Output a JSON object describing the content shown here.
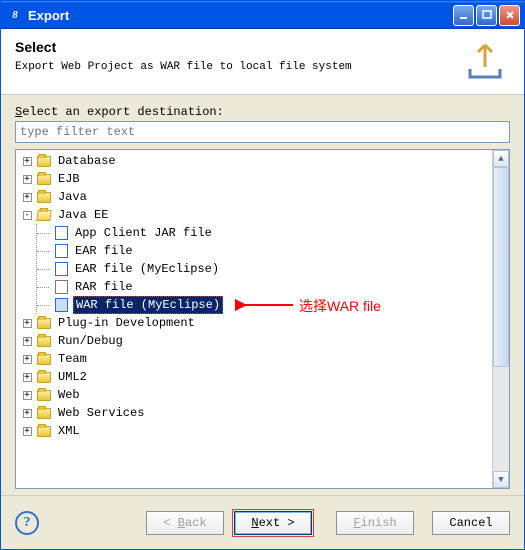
{
  "window": {
    "title": "Export"
  },
  "header": {
    "title": "Select",
    "subtitle": "Export Web Project as WAR file to local file system"
  },
  "prompt": {
    "first_char": "S",
    "rest": "elect an export destination:"
  },
  "filter": {
    "placeholder": "type filter text"
  },
  "tree": {
    "database": "Database",
    "ejb": "EJB",
    "java": "Java",
    "javaee": {
      "label": "Java EE",
      "app_client_jar": "App Client JAR file",
      "ear_file": "EAR file",
      "ear_file_myeclipse": "EAR file (MyEclipse)",
      "rar_file": "RAR file",
      "war_file_myeclipse": "WAR file (MyEclipse)"
    },
    "plugin_dev": "Plug-in Development",
    "run_debug": "Run/Debug",
    "team": "Team",
    "uml2": "UML2",
    "web": "Web",
    "web_services": "Web Services",
    "xml": "XML"
  },
  "annotation": {
    "text": "选择WAR file"
  },
  "buttons": {
    "back_u": "B",
    "back_rest": "ack",
    "next_u": "N",
    "next_rest": "ext",
    "finish_u": "F",
    "finish_rest": "inish",
    "cancel": "Cancel"
  }
}
